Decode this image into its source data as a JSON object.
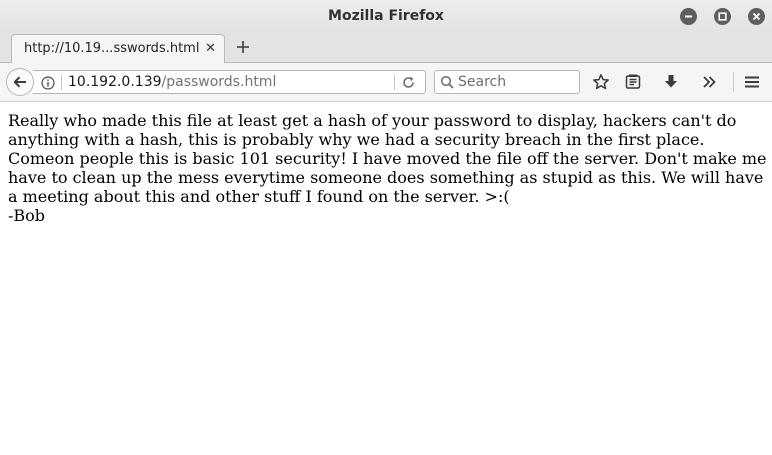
{
  "window": {
    "title": "Mozilla Firefox"
  },
  "tabs": [
    {
      "label": "http://10.19...sswords.html",
      "close": "✕"
    }
  ],
  "navbar": {
    "url_host": "10.192.0.139",
    "url_path": "/passwords.html",
    "search_placeholder": "Search"
  },
  "icons": {
    "minimize": "minimize-icon",
    "maximize": "maximize-icon",
    "close": "close-icon",
    "back": "back-arrow-icon",
    "info": "info-icon",
    "reload": "reload-icon",
    "search": "search-icon",
    "bookmark": "star-icon",
    "reader": "reader-list-icon",
    "downloads": "download-arrow-icon",
    "overflow": "double-chevron-icon",
    "menu": "hamburger-menu-icon",
    "new_tab": "plus-icon"
  },
  "page": {
    "message": "Really who made this file at least get a hash of your password to display, hackers can't do anything with a hash, this is probably why we had a security breach in the first place. Comeon people this is basic 101 security! I have moved the file off the server. Don't make me have to clean up the mess everytime someone does something as stupid as this. We will have a meeting about this and other stuff I found on the server. >:(",
    "signature": "-Bob"
  },
  "colors": {
    "titlebar": "#e5e5e5",
    "window_button": "#5d5f5f",
    "url_path": "#737373"
  }
}
